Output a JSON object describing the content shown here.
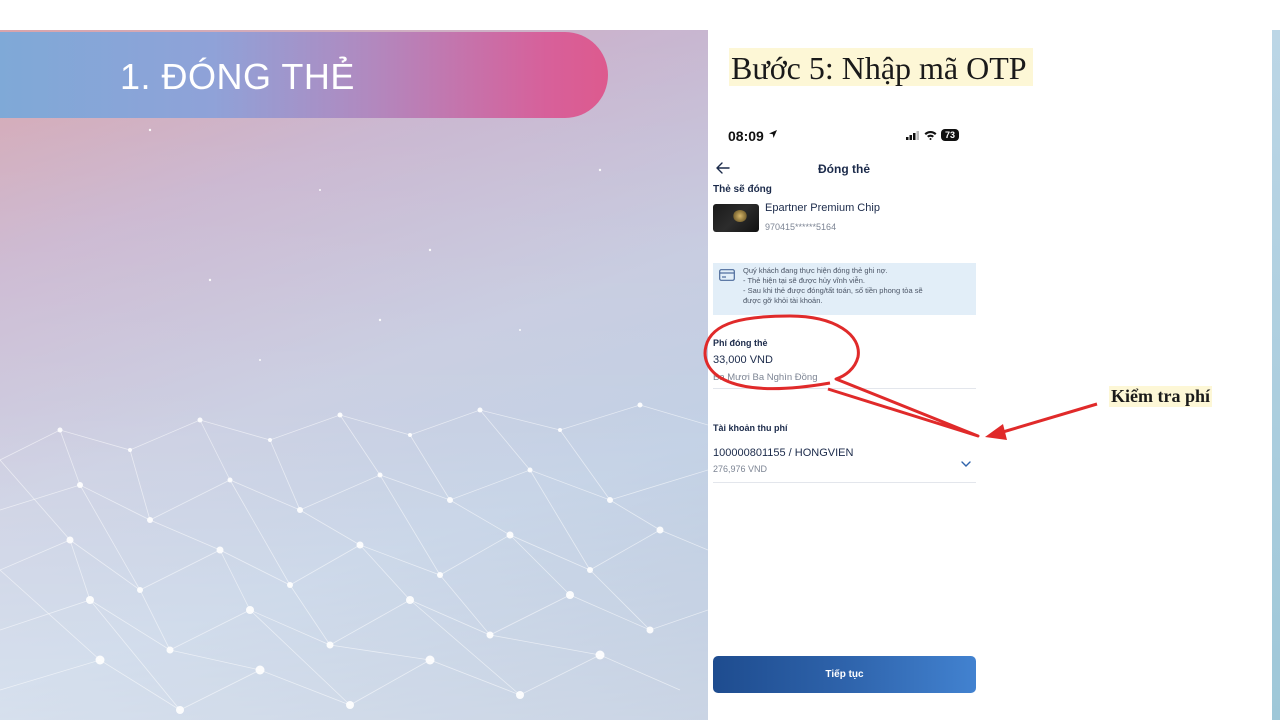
{
  "slide": {
    "title": "1. ĐÓNG THẺ",
    "step_title": "Bước 5: Nhập mã OTP",
    "annotation": "Kiểm tra phí"
  },
  "phone": {
    "status": {
      "time": "08:09",
      "battery": "73"
    },
    "header": {
      "title": "Đóng thẻ"
    },
    "card_section": {
      "label": "Thẻ sẽ đóng",
      "card_name": "Epartner Premium Chip",
      "card_number": "970415******5164"
    },
    "notice": {
      "line1": "Quý khách đang thực hiện đóng thẻ ghi nợ.",
      "line2": "- Thẻ hiện tại sẽ được hủy vĩnh viễn.",
      "line3": "- Sau khi thẻ được đóng/tất toán, số tiền phong tỏa sẽ",
      "line4": "được gỡ khỏi tài khoản."
    },
    "fee": {
      "label": "Phí đóng thẻ",
      "amount": "33,000 VND",
      "in_words": "Ba Mươi Ba Nghìn Đồng"
    },
    "account": {
      "label": "Tài khoản thu phí",
      "number": "100000801155 / HONGVIEN",
      "balance": "276,976 VND"
    },
    "continue_label": "Tiếp tục"
  },
  "colors": {
    "banner_start": "#7fa9d7",
    "banner_end": "#dd5a8e",
    "button_start": "#1e4c8f",
    "button_end": "#4282d0",
    "annotation_red": "#e02a2a",
    "notice_bg": "#e2eef8"
  },
  "icons": [
    "location-arrow-icon",
    "signal-icon",
    "wifi-icon",
    "battery-icon",
    "back-arrow-icon",
    "card-icon",
    "chevron-down-icon"
  ]
}
